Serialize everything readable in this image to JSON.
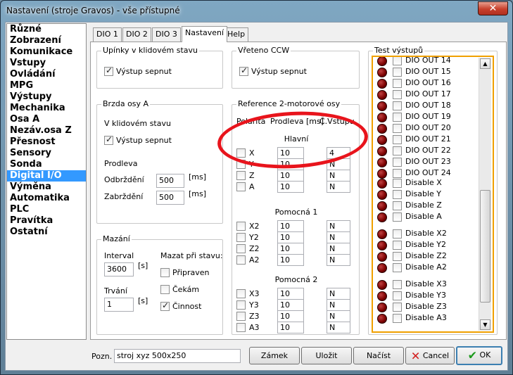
{
  "window": {
    "title": "Nastavení (stroje Gravos) - vše přístupné",
    "close_label": "✕"
  },
  "sidebar": {
    "items": [
      {
        "label": "Různé"
      },
      {
        "label": "Zobrazení"
      },
      {
        "label": "Komunikace"
      },
      {
        "label": "Vstupy"
      },
      {
        "label": "Ovládání"
      },
      {
        "label": "MPG"
      },
      {
        "label": "Výstupy"
      },
      {
        "label": "Mechanika"
      },
      {
        "label": "Osa A"
      },
      {
        "label": "Nezáv.osa Z"
      },
      {
        "label": "Přesnost"
      },
      {
        "label": "Sensory"
      },
      {
        "label": "Sonda"
      },
      {
        "label": "Digital I/O",
        "selected": true
      },
      {
        "label": "Výměna"
      },
      {
        "label": "Automatika"
      },
      {
        "label": "PLC"
      },
      {
        "label": "Pravítka"
      },
      {
        "label": "Ostatní"
      }
    ]
  },
  "tabs": [
    {
      "label": "DIO 1"
    },
    {
      "label": "DIO 2"
    },
    {
      "label": "DIO 3"
    },
    {
      "label": "Nastavení",
      "active": true
    },
    {
      "label": "Help"
    }
  ],
  "upinky": {
    "title": "Upínky v klidovém stavu",
    "cb_label": "Výstup sepnut",
    "checked": true
  },
  "vreteno": {
    "title": "Vřeteno CCW",
    "cb_label": "Výstup sepnut",
    "checked": true
  },
  "brzda": {
    "title": "Brzda osy A",
    "idle_label": "V klidovém stavu",
    "cb_label": "Výstup sepnut",
    "checked": true,
    "delay_label": "Prodleva",
    "release_label": "Odbrždění",
    "release_value": "500",
    "release_unit": "[ms]",
    "brake_label": "Zabrždění",
    "brake_value": "500",
    "brake_unit": "[ms]"
  },
  "mazani": {
    "title": "Mazání",
    "interval_label": "Interval",
    "interval_value": "3600",
    "interval_unit": "[s]",
    "duration_label": "Trvání",
    "duration_value": "1",
    "duration_unit": "[s]",
    "state_label": "Mazat při stavu:",
    "states": [
      {
        "label": "Připraven",
        "checked": false
      },
      {
        "label": "Čekám",
        "checked": false
      },
      {
        "label": "Činnost",
        "checked": true
      }
    ]
  },
  "reference": {
    "title": "Reference 2-motorové osy",
    "col_polarity": "Polarita",
    "col_delay": "Prodleva [ms]",
    "col_input": "Č.Vstupu",
    "groups": [
      {
        "title": "Hlavní",
        "rows": [
          {
            "axis": "X",
            "delay": "10",
            "input": "4"
          },
          {
            "axis": "Y",
            "delay": "10",
            "input": "N"
          },
          {
            "axis": "Z",
            "delay": "10",
            "input": "N"
          },
          {
            "axis": "A",
            "delay": "10",
            "input": "N"
          }
        ]
      },
      {
        "title": "Pomocná 1",
        "rows": [
          {
            "axis": "X2",
            "delay": "10",
            "input": "N"
          },
          {
            "axis": "Y2",
            "delay": "10",
            "input": "N"
          },
          {
            "axis": "Z2",
            "delay": "10",
            "input": "N"
          },
          {
            "axis": "A2",
            "delay": "10",
            "input": "N"
          }
        ]
      },
      {
        "title": "Pomocná 2",
        "rows": [
          {
            "axis": "X3",
            "delay": "10",
            "input": "N"
          },
          {
            "axis": "Y3",
            "delay": "10",
            "input": "N"
          },
          {
            "axis": "Z3",
            "delay": "10",
            "input": "N"
          },
          {
            "axis": "A3",
            "delay": "10",
            "input": "N"
          }
        ]
      }
    ]
  },
  "test_outputs": {
    "title": "Test výstupů",
    "blocks": [
      [
        "DIO OUT 14",
        "DIO OUT 15",
        "DIO OUT 16",
        "DIO OUT 17",
        "DIO OUT 18",
        "DIO OUT 19",
        "DIO OUT 20",
        "DIO OUT 21",
        "DIO OUT 22",
        "DIO OUT 23",
        "DIO OUT 24"
      ],
      [
        "Disable X",
        "Disable Y",
        "Disable Z",
        "Disable A"
      ],
      [
        "Disable X2",
        "Disable Y2",
        "Disable Z2",
        "Disable A2"
      ],
      [
        "Disable X3",
        "Disable Y3",
        "Disable Z3",
        "Disable A3"
      ]
    ],
    "scroll_position": 0.88
  },
  "footer": {
    "note_label": "Pozn.",
    "note_value": "stroj xyz 500x250",
    "lock_label": "Zámek",
    "save_label": "Uložit",
    "load_label": "Načíst",
    "cancel_label": "Cancel",
    "ok_label": "OK",
    "cancel_color": "#d21c1c",
    "ok_color": "#1c9a1c"
  }
}
